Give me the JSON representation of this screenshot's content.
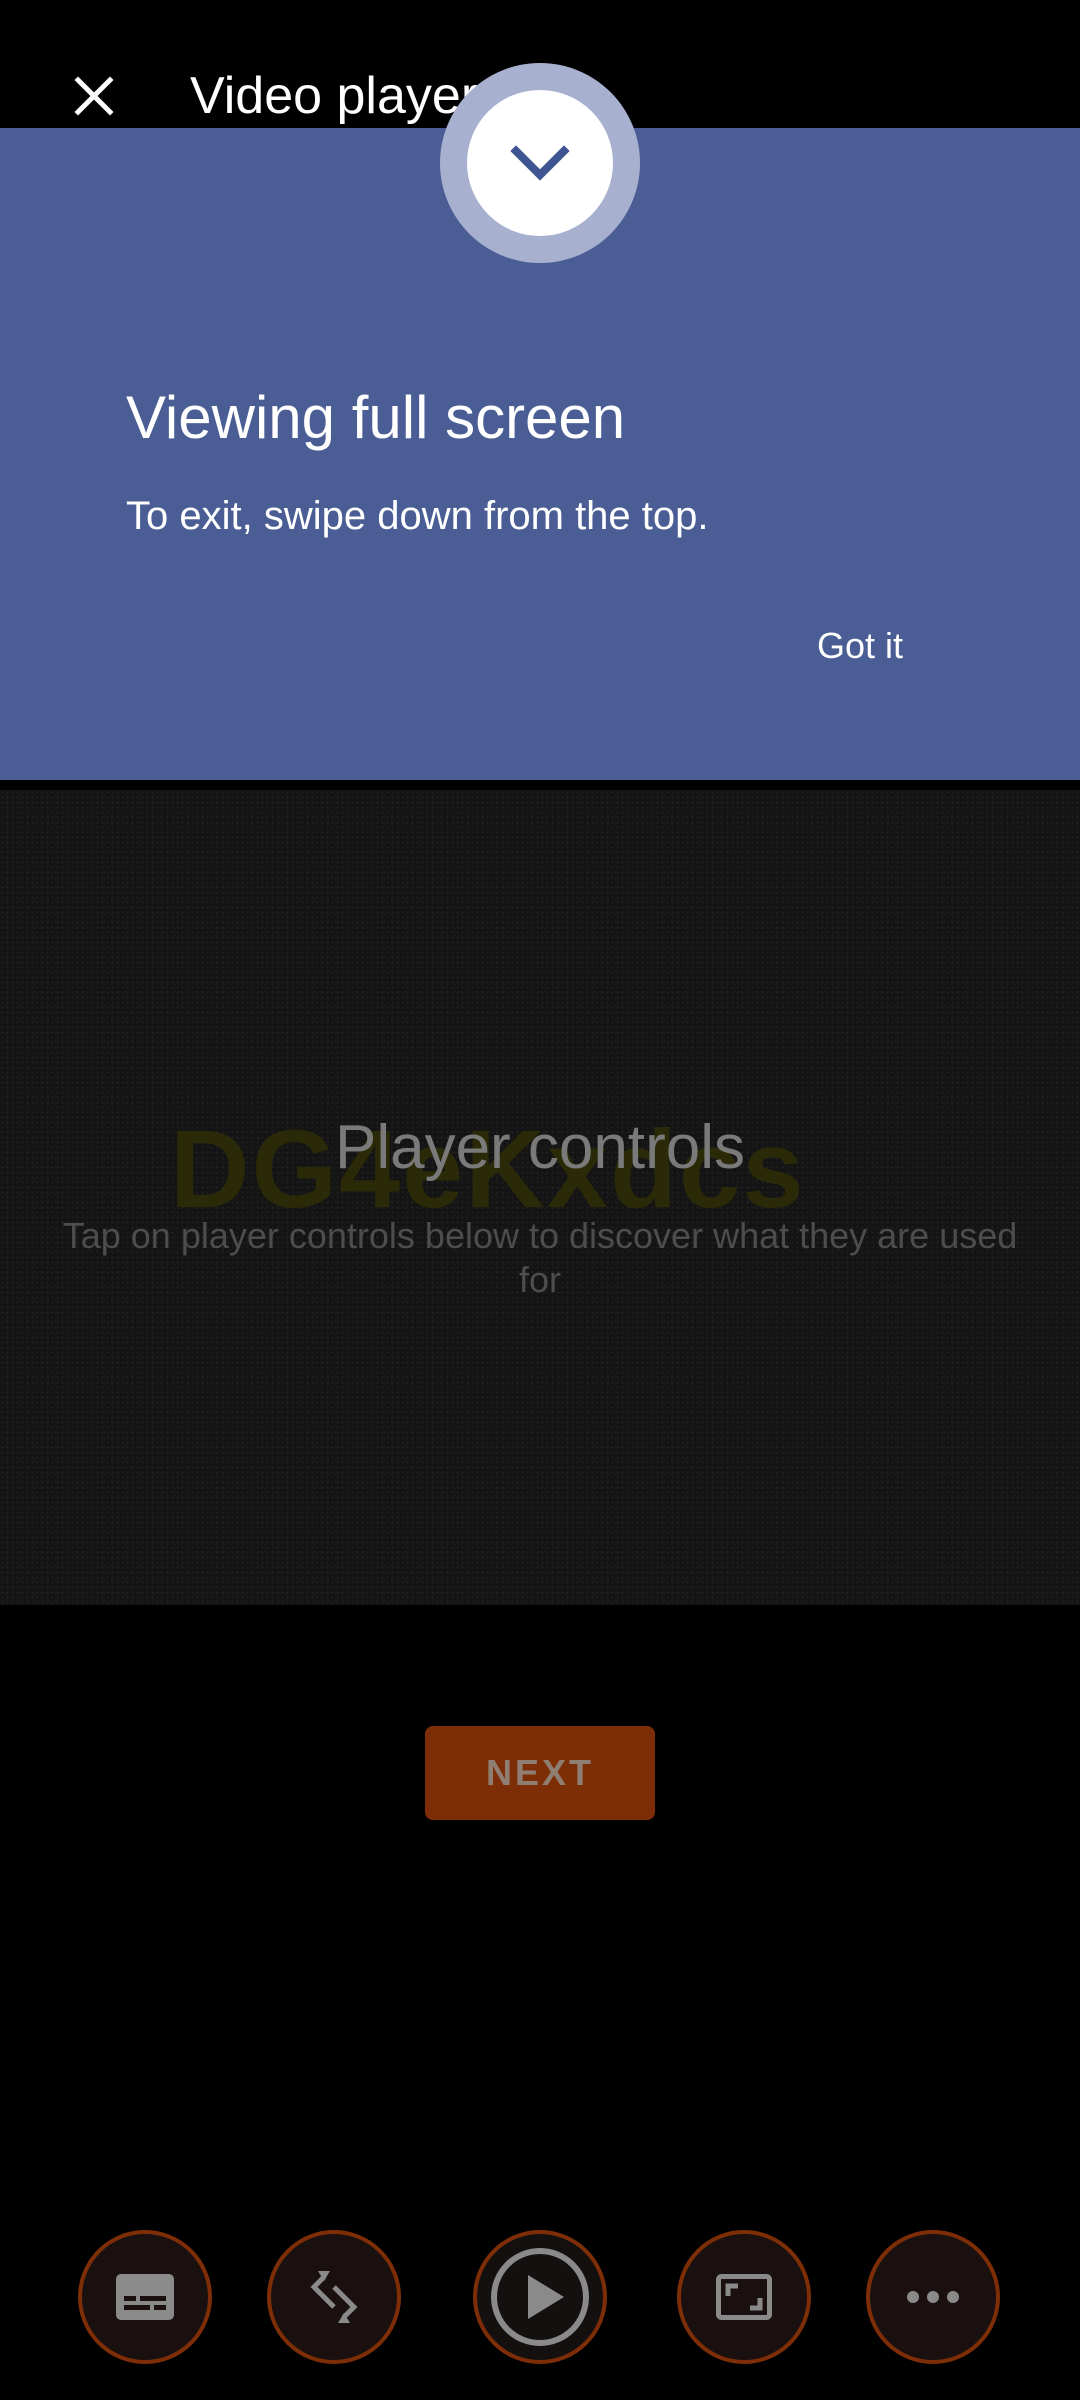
{
  "app_bar": {
    "title": "Video player tips",
    "close_icon": "close-icon"
  },
  "tip": {
    "title": "Viewing full screen",
    "body": "To exit, swipe down from the top.",
    "action_label": "Got it",
    "icon": "chevron-down-icon",
    "color": "#4a5e95"
  },
  "overlay": {
    "title": "Player controls",
    "description": "Tap on player controls below to discover what they are used for",
    "watermark": "DG4eKxdcs"
  },
  "next_button": {
    "label": "NEXT",
    "color": "#7e2e06"
  },
  "controls": [
    {
      "name": "subtitles",
      "icon": "subtitles-icon"
    },
    {
      "name": "rotate",
      "icon": "rotate-icon"
    },
    {
      "name": "play",
      "icon": "play-icon"
    },
    {
      "name": "aspect-ratio",
      "icon": "aspect-ratio-icon"
    },
    {
      "name": "more",
      "icon": "more-icon"
    }
  ]
}
